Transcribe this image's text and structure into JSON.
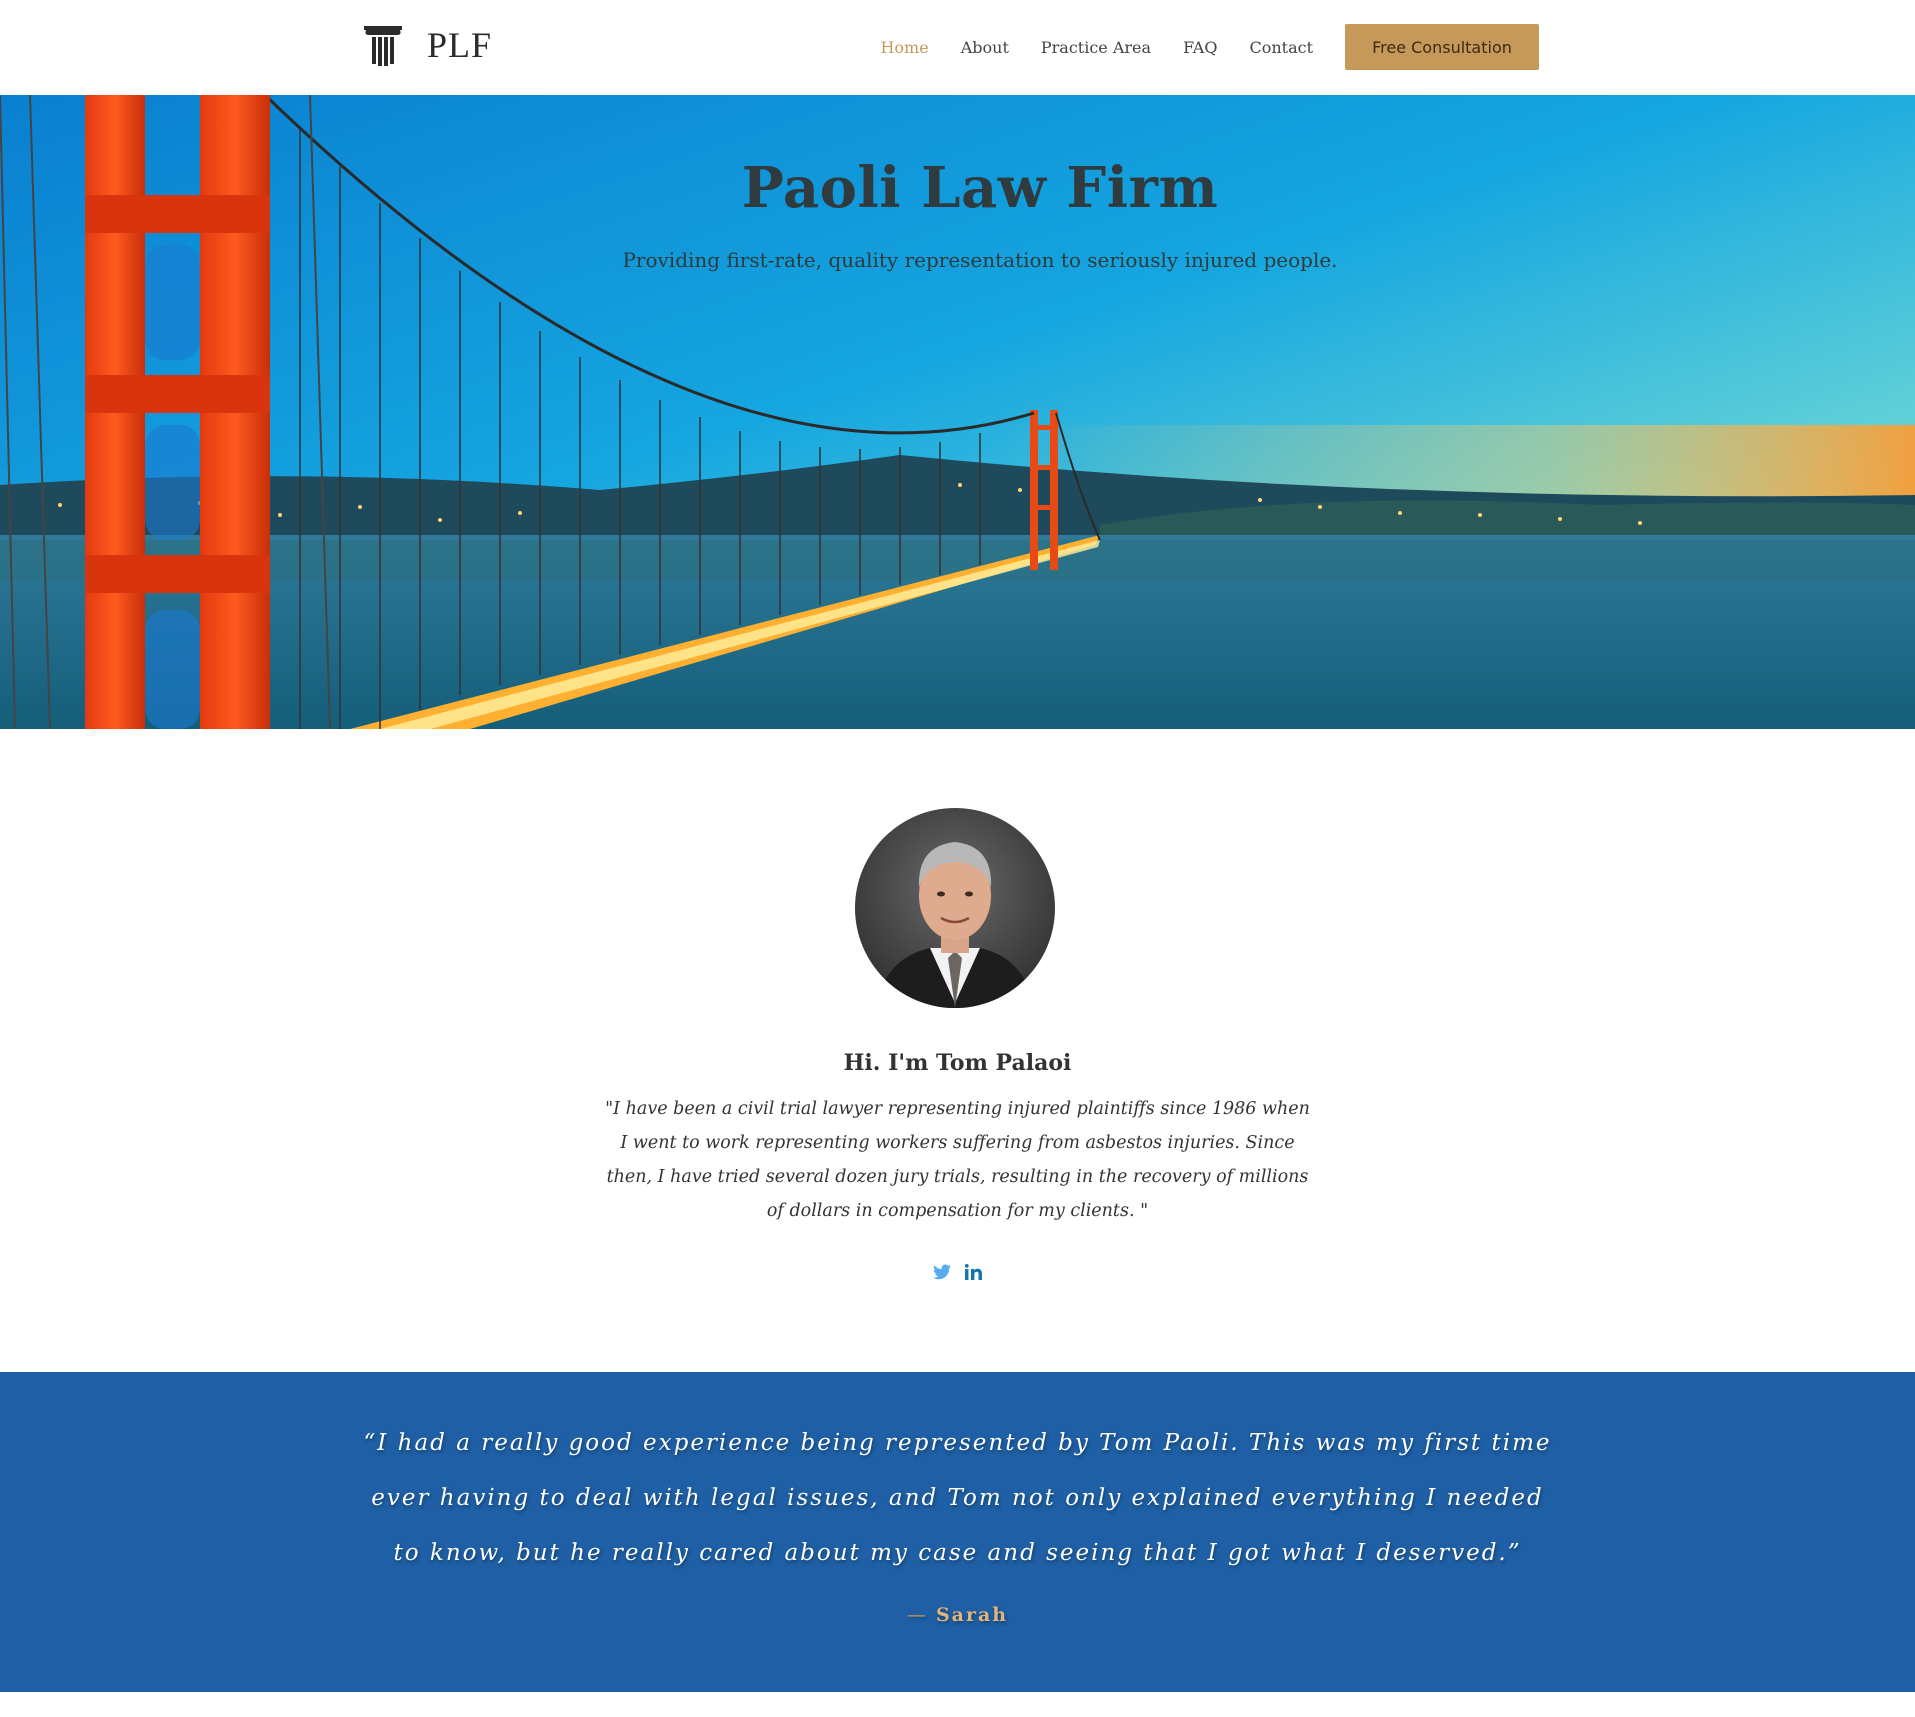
{
  "header": {
    "logo_text": "PLF",
    "logo_icon": "pillar-icon",
    "nav": [
      {
        "label": "Home",
        "active": true
      },
      {
        "label": "About",
        "active": false
      },
      {
        "label": "Practice Area",
        "active": false
      },
      {
        "label": "FAQ",
        "active": false
      },
      {
        "label": "Contact",
        "active": false
      }
    ],
    "cta_label": "Free Consultation"
  },
  "hero": {
    "title": "Paoli Law Firm",
    "subtitle": "Providing first-rate, quality representation to seriously injured people."
  },
  "about": {
    "heading": "Hi. I'm Tom Palaoi",
    "quote": "\"I have been a civil trial lawyer representing injured plaintiffs since 1986 when I went to work representing workers suffering from asbestos injuries. Since then, I have tried several dozen jury trials, resulting in the recovery of millions of dollars in compensation for my clients. \"",
    "social": [
      {
        "icon": "twitter-icon",
        "color": "#55acee"
      },
      {
        "icon": "linkedin-icon",
        "color": "#0e76a8"
      }
    ]
  },
  "testimonial": {
    "quote": "“I had a really good experience being represented by Tom Paoli. This was my first time ever having to deal with legal issues, and Tom not only explained everything I needed to know, but he really cared about my case and seeing that I got what I deserved.”",
    "dash": "—",
    "author": "Sarah"
  },
  "colors": {
    "accent": "#c4995a",
    "testimonial_bg": "#1e5fa5",
    "text": "#333333"
  }
}
